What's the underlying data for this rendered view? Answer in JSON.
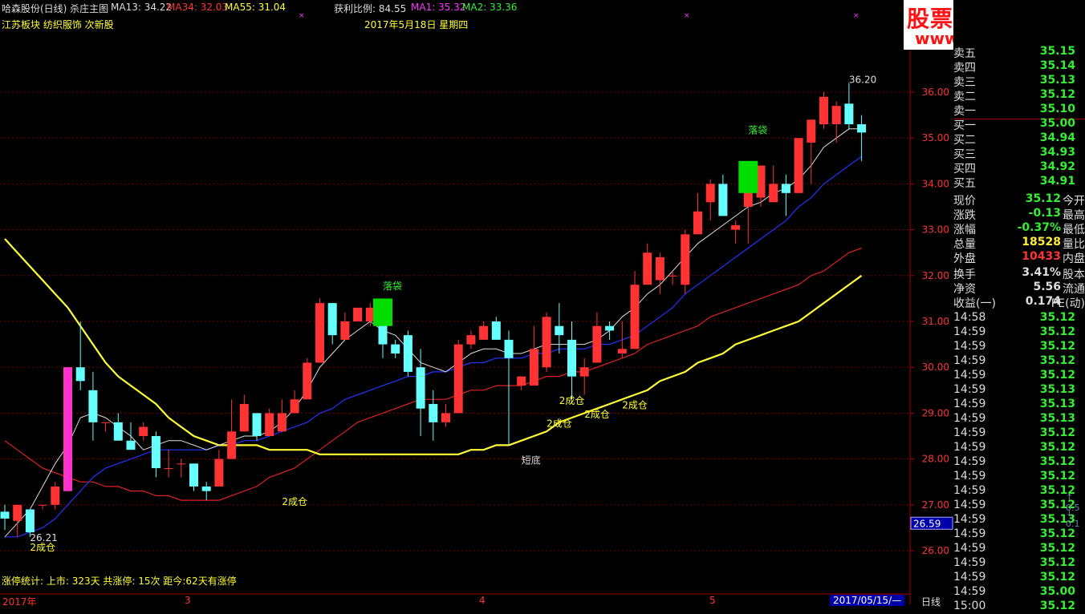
{
  "header": {
    "title": "哈森股份(日线) 杀庄主图",
    "ma13": "MA13: 34.22",
    "ma34": "MA34: 32.03",
    "ma55": "MA55: 31.04",
    "profit": "获利比例: 84.55",
    "ma1": "MA1: 35.32",
    "ma2": "MA2: 33.36",
    "sector": "江苏板块 纺织服饰 次新股",
    "date": "2017年5月18日 星期四"
  },
  "watermark": {
    "line1": "股票公式指标网",
    "line2": "www.gszx.com.cn"
  },
  "footer": {
    "stats": "涨停统计:  上市: 323天   共涨停: 15次   距今:62天有涨停",
    "months": [
      "2017年",
      "3",
      "4",
      "5"
    ],
    "cursor_date": "2017/05/15/—",
    "period": "日线"
  },
  "order_book": [
    {
      "label": "卖五",
      "value": "35.15"
    },
    {
      "label": "卖四",
      "value": "35.14"
    },
    {
      "label": "卖三",
      "value": "35.13"
    },
    {
      "label": "卖二",
      "value": "35.12"
    },
    {
      "label": "卖一",
      "value": "35.10"
    },
    {
      "label": "买一",
      "value": "35.00"
    },
    {
      "label": "买二",
      "value": "34.94"
    },
    {
      "label": "买三",
      "value": "34.93"
    },
    {
      "label": "买四",
      "value": "34.92"
    },
    {
      "label": "买五",
      "value": "34.91"
    }
  ],
  "quote": [
    {
      "label": "现价",
      "value": "35.12",
      "label2": "今开",
      "color": "#33ee33"
    },
    {
      "label": "涨跌",
      "value": "-0.13",
      "label2": "最高",
      "color": "#33ee33"
    },
    {
      "label": "涨幅",
      "value": "-0.37%",
      "label2": "最低",
      "color": "#33ee33"
    },
    {
      "label": "总量",
      "value": "18528",
      "label2": "量比",
      "color": "#ffee33"
    },
    {
      "label": "外盘",
      "value": "10433",
      "label2": "内盘",
      "color": "#ff3333"
    },
    {
      "label": "换手",
      "value": "3.41%",
      "label2": "股本",
      "color": "#dddddd"
    },
    {
      "label": "净资",
      "value": "5.56",
      "label2": "流通",
      "color": "#dddddd"
    },
    {
      "label": "收益(一)",
      "value": "0.174",
      "label2": "PE(动)",
      "color": "#dddddd"
    }
  ],
  "ticks": [
    {
      "t": "14:58",
      "p": "35.12"
    },
    {
      "t": "14:59",
      "p": "35.12"
    },
    {
      "t": "14:59",
      "p": "35.12"
    },
    {
      "t": "14:59",
      "p": "35.12"
    },
    {
      "t": "14:59",
      "p": "35.12"
    },
    {
      "t": "14:59",
      "p": "35.13"
    },
    {
      "t": "14:59",
      "p": "35.13"
    },
    {
      "t": "14:59",
      "p": "35.13"
    },
    {
      "t": "14:59",
      "p": "35.12"
    },
    {
      "t": "14:59",
      "p": "35.12"
    },
    {
      "t": "14:59",
      "p": "35.12"
    },
    {
      "t": "14:59",
      "p": "35.12"
    },
    {
      "t": "14:59",
      "p": "35.12"
    },
    {
      "t": "14:59",
      "p": "35.12"
    },
    {
      "t": "14:59",
      "p": "35.13"
    },
    {
      "t": "14:59",
      "p": "35.12"
    },
    {
      "t": "14:59",
      "p": "35.12"
    },
    {
      "t": "14:59",
      "p": "35.12"
    },
    {
      "t": "14:59",
      "p": "35.12"
    },
    {
      "t": "14:59",
      "p": "35.00"
    },
    {
      "t": "15:00",
      "p": "35.12"
    }
  ],
  "side_markers": [
    "0.5",
    "0.1"
  ],
  "colors": {
    "up": "#ff3333",
    "down": "#66ffff",
    "ma_white": "#dddddd",
    "ma_blue": "#2233ff",
    "ma_red": "#dd2222",
    "ma_yellow": "#ffff33",
    "grid": "#7a0000",
    "accent_green": "#33ee33"
  },
  "chart_data": {
    "type": "candlestick",
    "ylim": [
      25.5,
      36.6
    ],
    "y_ticks": [
      "36.00",
      "35.00",
      "34.00",
      "33.00",
      "32.00",
      "31.00",
      "30.00",
      "29.00",
      "28.00",
      "27.00",
      "26.00"
    ],
    "current_price_label": "26.59",
    "candles": [
      [
        26.85,
        27.0,
        26.45,
        26.7
      ],
      [
        26.65,
        26.9,
        26.3,
        27.0
      ],
      [
        26.9,
        26.9,
        26.3,
        26.4
      ],
      [
        27.0,
        27.0,
        26.9,
        27.0
      ],
      [
        27.0,
        27.5,
        26.9,
        27.4
      ],
      [
        27.3,
        30.0,
        27.3,
        30.0
      ],
      [
        30.0,
        31.0,
        29.5,
        29.7
      ],
      [
        29.5,
        29.9,
        28.4,
        28.8
      ],
      [
        28.8,
        28.8,
        28.6,
        28.8
      ],
      [
        28.8,
        29.0,
        28.6,
        28.4
      ],
      [
        28.4,
        28.8,
        28.2,
        28.2
      ],
      [
        28.5,
        28.8,
        28.4,
        28.7
      ],
      [
        28.5,
        28.6,
        27.6,
        27.8
      ],
      [
        27.8,
        28.2,
        27.6,
        27.8
      ],
      [
        27.9,
        28.0,
        27.6,
        27.9
      ],
      [
        27.9,
        27.9,
        27.3,
        27.4
      ],
      [
        27.4,
        27.5,
        27.1,
        27.3
      ],
      [
        27.4,
        28.2,
        27.4,
        28.0
      ],
      [
        28.0,
        29.3,
        28.0,
        28.6
      ],
      [
        28.6,
        29.4,
        28.6,
        29.2
      ],
      [
        29.0,
        29.0,
        28.4,
        28.5
      ],
      [
        28.5,
        29.1,
        28.5,
        29.0
      ],
      [
        28.6,
        29.3,
        28.6,
        29.0
      ],
      [
        29.0,
        29.5,
        29.0,
        29.3
      ],
      [
        29.3,
        30.2,
        29.3,
        30.1
      ],
      [
        30.1,
        31.5,
        30.1,
        31.4
      ],
      [
        31.4,
        31.4,
        30.5,
        30.7
      ],
      [
        30.6,
        31.2,
        30.6,
        31.0
      ],
      [
        31.0,
        31.3,
        31.0,
        31.3
      ],
      [
        31.0,
        31.4,
        30.9,
        31.3
      ],
      [
        31.3,
        31.5,
        30.2,
        30.5
      ],
      [
        30.5,
        30.6,
        30.2,
        30.3
      ],
      [
        30.7,
        30.8,
        29.8,
        29.9
      ],
      [
        30.0,
        30.4,
        28.5,
        29.1
      ],
      [
        29.2,
        29.5,
        28.4,
        28.8
      ],
      [
        28.8,
        29.2,
        28.7,
        29.0
      ],
      [
        29.0,
        30.6,
        29.0,
        30.5
      ],
      [
        30.5,
        30.8,
        30.4,
        30.7
      ],
      [
        30.6,
        31.0,
        30.6,
        30.9
      ],
      [
        31.0,
        31.1,
        30.6,
        30.6
      ],
      [
        30.6,
        30.8,
        28.3,
        30.2
      ],
      [
        29.6,
        29.8,
        29.5,
        29.8
      ],
      [
        29.6,
        30.9,
        29.6,
        30.4
      ],
      [
        30.0,
        31.2,
        29.9,
        31.1
      ],
      [
        30.9,
        31.4,
        30.3,
        30.7
      ],
      [
        30.6,
        31.0,
        29.3,
        29.8
      ],
      [
        29.8,
        30.2,
        29.4,
        30.0
      ],
      [
        30.1,
        31.2,
        30.1,
        30.9
      ],
      [
        30.9,
        31.0,
        30.6,
        30.8
      ],
      [
        30.3,
        31.0,
        30.2,
        30.4
      ],
      [
        30.4,
        32.1,
        30.4,
        31.8
      ],
      [
        31.8,
        32.7,
        31.8,
        32.5
      ],
      [
        31.9,
        32.5,
        31.6,
        32.4
      ],
      [
        32.0,
        32.1,
        31.8,
        32.0
      ],
      [
        31.8,
        33.0,
        31.6,
        32.9
      ],
      [
        32.9,
        33.8,
        32.9,
        33.4
      ],
      [
        33.6,
        34.1,
        33.2,
        34.0
      ],
      [
        34.0,
        34.2,
        33.3,
        33.3
      ],
      [
        33.0,
        33.2,
        32.7,
        33.1
      ],
      [
        33.5,
        33.8,
        32.7,
        34.0
      ],
      [
        33.7,
        34.0,
        33.5,
        34.4
      ],
      [
        33.6,
        34.4,
        33.6,
        34.0
      ],
      [
        34.0,
        34.2,
        33.3,
        33.8
      ],
      [
        33.8,
        35.0,
        33.8,
        35.0
      ],
      [
        34.9,
        35.4,
        34.0,
        35.4
      ],
      [
        35.3,
        36.0,
        35.2,
        35.9
      ],
      [
        35.3,
        35.8,
        34.9,
        35.7
      ],
      [
        35.75,
        36.2,
        35.2,
        35.3
      ],
      [
        35.3,
        35.5,
        34.5,
        35.12
      ]
    ],
    "ma_white": [
      26.3,
      26.6,
      26.9,
      27.4,
      27.9,
      28.3,
      28.9,
      29.0,
      28.9,
      28.7,
      28.5,
      28.2,
      28.3,
      28.4,
      28.4,
      28.3,
      28.2,
      28.3,
      28.4,
      28.5,
      28.5,
      28.6,
      28.8,
      29.1,
      29.5,
      30.0,
      30.3,
      30.6,
      30.8,
      31.0,
      30.8,
      30.7,
      30.4,
      30.1,
      30.0,
      29.9,
      30.1,
      30.3,
      30.4,
      30.4,
      30.3,
      30.3,
      30.4,
      30.5,
      30.5,
      30.5,
      30.5,
      30.6,
      30.8,
      31.1,
      31.3,
      31.6,
      31.8,
      32.1,
      32.4,
      32.7,
      32.9,
      33.1,
      33.3,
      33.5,
      33.6,
      33.8,
      33.9,
      34.1,
      34.4,
      34.8,
      35.0,
      35.2,
      35.2
    ],
    "ma_blue": [
      26.3,
      26.3,
      26.4,
      26.5,
      26.7,
      27.0,
      27.3,
      27.6,
      27.8,
      27.9,
      28.0,
      28.1,
      28.2,
      28.2,
      28.2,
      28.2,
      28.2,
      28.3,
      28.3,
      28.4,
      28.4,
      28.5,
      28.6,
      28.7,
      28.8,
      29.0,
      29.1,
      29.3,
      29.4,
      29.5,
      29.6,
      29.7,
      29.8,
      29.8,
      29.9,
      29.9,
      30.0,
      30.1,
      30.1,
      30.2,
      30.2,
      30.2,
      30.3,
      30.3,
      30.4,
      30.4,
      30.4,
      30.5,
      30.5,
      30.6,
      30.7,
      30.9,
      31.1,
      31.3,
      31.6,
      31.8,
      32.0,
      32.2,
      32.4,
      32.6,
      32.8,
      33.0,
      33.2,
      33.5,
      33.7,
      34.0,
      34.2,
      34.4,
      34.6
    ],
    "ma_red": [
      28.4,
      28.2,
      28.0,
      27.8,
      27.7,
      27.6,
      27.5,
      27.5,
      27.4,
      27.4,
      27.3,
      27.3,
      27.2,
      27.2,
      27.1,
      27.1,
      27.1,
      27.1,
      27.2,
      27.3,
      27.4,
      27.6,
      27.7,
      27.8,
      28.0,
      28.2,
      28.4,
      28.6,
      28.8,
      28.9,
      29.0,
      29.1,
      29.2,
      29.3,
      29.3,
      29.3,
      29.4,
      29.5,
      29.5,
      29.6,
      29.6,
      29.6,
      29.7,
      29.8,
      29.8,
      29.9,
      29.9,
      30.0,
      30.1,
      30.2,
      30.3,
      30.5,
      30.6,
      30.7,
      30.8,
      30.9,
      31.1,
      31.2,
      31.3,
      31.4,
      31.5,
      31.6,
      31.7,
      31.8,
      32.0,
      32.1,
      32.3,
      32.5,
      32.6
    ],
    "ma_yellow": [
      32.8,
      32.5,
      32.2,
      31.9,
      31.6,
      31.3,
      30.9,
      30.5,
      30.1,
      29.8,
      29.6,
      29.4,
      29.2,
      28.9,
      28.7,
      28.5,
      28.4,
      28.3,
      28.3,
      28.3,
      28.3,
      28.2,
      28.2,
      28.2,
      28.2,
      28.1,
      28.1,
      28.1,
      28.1,
      28.1,
      28.1,
      28.1,
      28.1,
      28.1,
      28.1,
      28.1,
      28.1,
      28.2,
      28.2,
      28.3,
      28.3,
      28.4,
      28.5,
      28.6,
      28.8,
      28.9,
      29.0,
      29.1,
      29.2,
      29.3,
      29.4,
      29.5,
      29.7,
      29.8,
      29.9,
      30.1,
      30.2,
      30.3,
      30.5,
      30.6,
      30.7,
      30.8,
      30.9,
      31.0,
      31.2,
      31.4,
      31.6,
      31.8,
      32.0
    ],
    "annotations": [
      {
        "text": "落袋",
        "index": 30,
        "price": 31.7,
        "color": "#33ee33"
      },
      {
        "text": "落袋",
        "index": 59,
        "price": 35.1,
        "color": "#33ee33"
      },
      {
        "text": "2成仓",
        "index": 22,
        "price": 27.0,
        "color": "#ffff33"
      },
      {
        "text": "2成仓",
        "index": 43,
        "price": 28.7,
        "color": "#ffff33"
      },
      {
        "text": "2成仓",
        "index": 44,
        "price": 29.2,
        "color": "#ffff33"
      },
      {
        "text": "2成仓",
        "index": 46,
        "price": 28.9,
        "color": "#ffff33"
      },
      {
        "text": "2成仓",
        "index": 49,
        "price": 29.1,
        "color": "#ffff33"
      },
      {
        "text": "2成仓",
        "index": 2,
        "price": 26.0,
        "color": "#ffff33"
      },
      {
        "text": "短底",
        "index": 41,
        "price": 27.9,
        "color": "#dddddd"
      },
      {
        "text": "36.20",
        "index": 67,
        "price": 36.2,
        "color": "#dddddd"
      },
      {
        "text": "26.21",
        "index": 2,
        "price": 26.21,
        "color": "#dddddd"
      }
    ],
    "green_boxes": [
      {
        "index": 30,
        "open": 30.9,
        "close": 31.5
      },
      {
        "index": 59,
        "open": 33.8,
        "close": 34.5
      }
    ],
    "limit_up_bar_index": 5
  }
}
